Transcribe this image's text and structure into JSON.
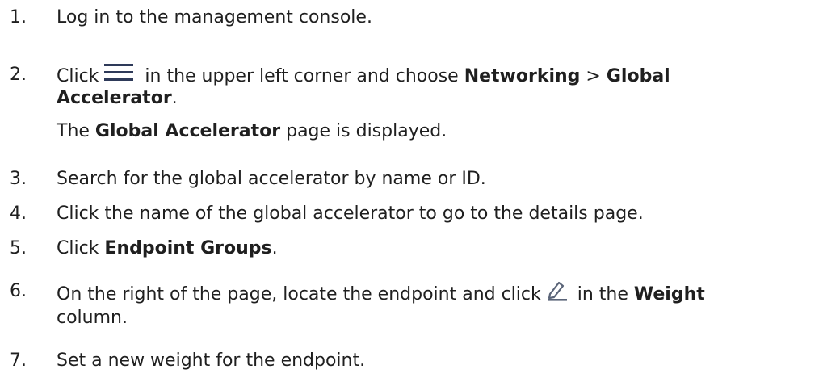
{
  "steps": [
    {
      "num": "1.",
      "text": "Log in to the management console."
    },
    {
      "num": "2.",
      "click": "Click",
      "after_icon": " in the upper left corner and choose ",
      "menu1": "Networking",
      "sep": " > ",
      "menu2a": "Global",
      "menu2b": "Accelerator",
      "end": ".",
      "note_pre": "The ",
      "note_bold": "Global Accelerator",
      "note_post": " page is displayed."
    },
    {
      "num": "3.",
      "text": "Search for the global accelerator by name or ID."
    },
    {
      "num": "4.",
      "text": "Click the name of the global accelerator to go to the details page."
    },
    {
      "num": "5.",
      "click": "Click ",
      "bold": "Endpoint Groups",
      "end": "."
    },
    {
      "num": "6.",
      "pre": "On the right of the page, locate the endpoint and click",
      "post": " in the ",
      "bold": "Weight",
      "line2": "column."
    },
    {
      "num": "7.",
      "text": "Set a new weight for the endpoint."
    }
  ],
  "icons": {
    "menu": "hamburger-menu-icon",
    "edit": "edit-pencil-icon",
    "icon_color": "#2e3a59",
    "edit_color": "#5a6478"
  }
}
